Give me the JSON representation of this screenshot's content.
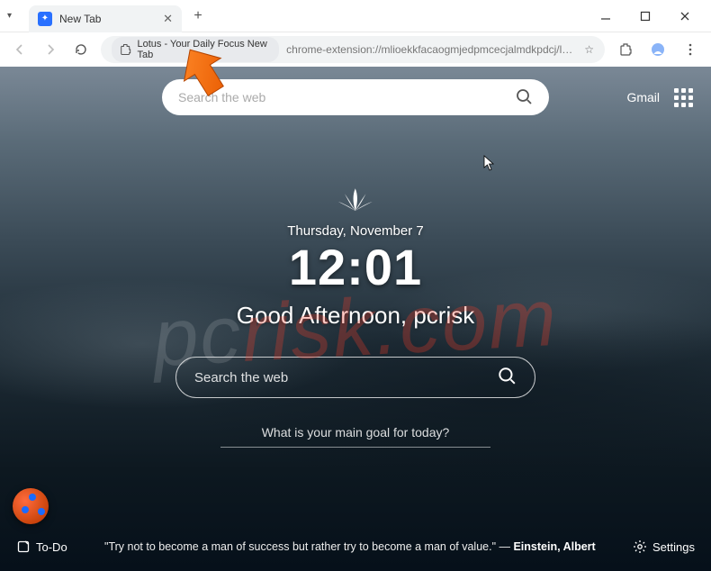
{
  "window": {
    "tab_title": "New Tab",
    "new_tab_plus": "+"
  },
  "address": {
    "site_name": "Lotus - Your Daily Focus New Tab",
    "url": "chrome-extension://mlioekkfacaogmjedpmcecjalmdkpdcj/lotus.html"
  },
  "topbar": {
    "search_placeholder": "Search the web",
    "gmail": "Gmail"
  },
  "center": {
    "date": "Thursday, November 7",
    "time": "12:01",
    "greeting": "Good Afternoon, pcrisk"
  },
  "main_search": {
    "placeholder": "Search the web"
  },
  "goal": {
    "placeholder": "What is your main goal for today?"
  },
  "bottom": {
    "todo": "To-Do",
    "quote_text": "\"Try not to become a man of success but rather try to become a man of value.\" — ",
    "quote_author": "Einstein, Albert",
    "settings": "Settings"
  },
  "watermark": {
    "a": "pc",
    "b": "risk.com"
  }
}
